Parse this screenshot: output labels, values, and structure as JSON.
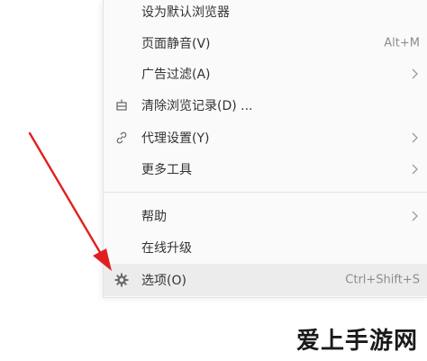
{
  "menu": {
    "items": [
      {
        "label": "设为默认浏览器",
        "shortcut": "",
        "icon": "",
        "has_submenu": false
      },
      {
        "label": "页面静音(V)",
        "shortcut": "Alt+M",
        "icon": "",
        "has_submenu": false
      },
      {
        "label": "广告过滤(A)",
        "shortcut": "",
        "icon": "",
        "has_submenu": true
      },
      {
        "label": "清除浏览记录(D) ...",
        "shortcut": "",
        "icon": "clear-icon",
        "has_submenu": false
      },
      {
        "label": "代理设置(Y)",
        "shortcut": "",
        "icon": "link-icon",
        "has_submenu": true
      },
      {
        "label": "更多工具",
        "shortcut": "",
        "icon": "",
        "has_submenu": true
      },
      {
        "label": "帮助",
        "shortcut": "",
        "icon": "",
        "has_submenu": true
      },
      {
        "label": "在线升级",
        "shortcut": "",
        "icon": "",
        "has_submenu": false
      },
      {
        "label": "选项(O)",
        "shortcut": "Ctrl+Shift+S",
        "icon": "gear-icon",
        "has_submenu": false,
        "highlighted": true
      }
    ]
  },
  "annotation": {
    "color": "#e02020"
  },
  "watermark": {
    "text": "爱上手游网"
  },
  "colors": {
    "menu_bg": "#fafafa",
    "highlight_bg": "#ececec",
    "text": "#333333",
    "shortcut_text": "#8d8d8d"
  }
}
